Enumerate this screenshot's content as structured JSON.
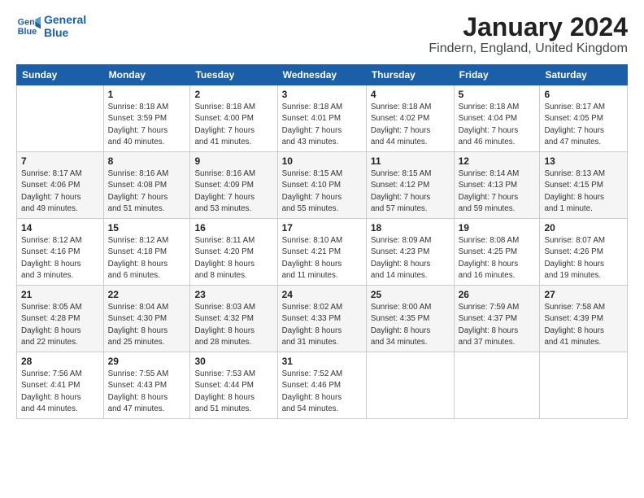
{
  "logo": {
    "line1": "General",
    "line2": "Blue"
  },
  "title": "January 2024",
  "subtitle": "Findern, England, United Kingdom",
  "days_of_week": [
    "Sunday",
    "Monday",
    "Tuesday",
    "Wednesday",
    "Thursday",
    "Friday",
    "Saturday"
  ],
  "weeks": [
    [
      {
        "day": "",
        "info": ""
      },
      {
        "day": "1",
        "info": "Sunrise: 8:18 AM\nSunset: 3:59 PM\nDaylight: 7 hours\nand 40 minutes."
      },
      {
        "day": "2",
        "info": "Sunrise: 8:18 AM\nSunset: 4:00 PM\nDaylight: 7 hours\nand 41 minutes."
      },
      {
        "day": "3",
        "info": "Sunrise: 8:18 AM\nSunset: 4:01 PM\nDaylight: 7 hours\nand 43 minutes."
      },
      {
        "day": "4",
        "info": "Sunrise: 8:18 AM\nSunset: 4:02 PM\nDaylight: 7 hours\nand 44 minutes."
      },
      {
        "day": "5",
        "info": "Sunrise: 8:18 AM\nSunset: 4:04 PM\nDaylight: 7 hours\nand 46 minutes."
      },
      {
        "day": "6",
        "info": "Sunrise: 8:17 AM\nSunset: 4:05 PM\nDaylight: 7 hours\nand 47 minutes."
      }
    ],
    [
      {
        "day": "7",
        "info": "Sunrise: 8:17 AM\nSunset: 4:06 PM\nDaylight: 7 hours\nand 49 minutes."
      },
      {
        "day": "8",
        "info": "Sunrise: 8:16 AM\nSunset: 4:08 PM\nDaylight: 7 hours\nand 51 minutes."
      },
      {
        "day": "9",
        "info": "Sunrise: 8:16 AM\nSunset: 4:09 PM\nDaylight: 7 hours\nand 53 minutes."
      },
      {
        "day": "10",
        "info": "Sunrise: 8:15 AM\nSunset: 4:10 PM\nDaylight: 7 hours\nand 55 minutes."
      },
      {
        "day": "11",
        "info": "Sunrise: 8:15 AM\nSunset: 4:12 PM\nDaylight: 7 hours\nand 57 minutes."
      },
      {
        "day": "12",
        "info": "Sunrise: 8:14 AM\nSunset: 4:13 PM\nDaylight: 7 hours\nand 59 minutes."
      },
      {
        "day": "13",
        "info": "Sunrise: 8:13 AM\nSunset: 4:15 PM\nDaylight: 8 hours\nand 1 minute."
      }
    ],
    [
      {
        "day": "14",
        "info": "Sunrise: 8:12 AM\nSunset: 4:16 PM\nDaylight: 8 hours\nand 3 minutes."
      },
      {
        "day": "15",
        "info": "Sunrise: 8:12 AM\nSunset: 4:18 PM\nDaylight: 8 hours\nand 6 minutes."
      },
      {
        "day": "16",
        "info": "Sunrise: 8:11 AM\nSunset: 4:20 PM\nDaylight: 8 hours\nand 8 minutes."
      },
      {
        "day": "17",
        "info": "Sunrise: 8:10 AM\nSunset: 4:21 PM\nDaylight: 8 hours\nand 11 minutes."
      },
      {
        "day": "18",
        "info": "Sunrise: 8:09 AM\nSunset: 4:23 PM\nDaylight: 8 hours\nand 14 minutes."
      },
      {
        "day": "19",
        "info": "Sunrise: 8:08 AM\nSunset: 4:25 PM\nDaylight: 8 hours\nand 16 minutes."
      },
      {
        "day": "20",
        "info": "Sunrise: 8:07 AM\nSunset: 4:26 PM\nDaylight: 8 hours\nand 19 minutes."
      }
    ],
    [
      {
        "day": "21",
        "info": "Sunrise: 8:05 AM\nSunset: 4:28 PM\nDaylight: 8 hours\nand 22 minutes."
      },
      {
        "day": "22",
        "info": "Sunrise: 8:04 AM\nSunset: 4:30 PM\nDaylight: 8 hours\nand 25 minutes."
      },
      {
        "day": "23",
        "info": "Sunrise: 8:03 AM\nSunset: 4:32 PM\nDaylight: 8 hours\nand 28 minutes."
      },
      {
        "day": "24",
        "info": "Sunrise: 8:02 AM\nSunset: 4:33 PM\nDaylight: 8 hours\nand 31 minutes."
      },
      {
        "day": "25",
        "info": "Sunrise: 8:00 AM\nSunset: 4:35 PM\nDaylight: 8 hours\nand 34 minutes."
      },
      {
        "day": "26",
        "info": "Sunrise: 7:59 AM\nSunset: 4:37 PM\nDaylight: 8 hours\nand 37 minutes."
      },
      {
        "day": "27",
        "info": "Sunrise: 7:58 AM\nSunset: 4:39 PM\nDaylight: 8 hours\nand 41 minutes."
      }
    ],
    [
      {
        "day": "28",
        "info": "Sunrise: 7:56 AM\nSunset: 4:41 PM\nDaylight: 8 hours\nand 44 minutes."
      },
      {
        "day": "29",
        "info": "Sunrise: 7:55 AM\nSunset: 4:43 PM\nDaylight: 8 hours\nand 47 minutes."
      },
      {
        "day": "30",
        "info": "Sunrise: 7:53 AM\nSunset: 4:44 PM\nDaylight: 8 hours\nand 51 minutes."
      },
      {
        "day": "31",
        "info": "Sunrise: 7:52 AM\nSunset: 4:46 PM\nDaylight: 8 hours\nand 54 minutes."
      },
      {
        "day": "",
        "info": ""
      },
      {
        "day": "",
        "info": ""
      },
      {
        "day": "",
        "info": ""
      }
    ]
  ]
}
